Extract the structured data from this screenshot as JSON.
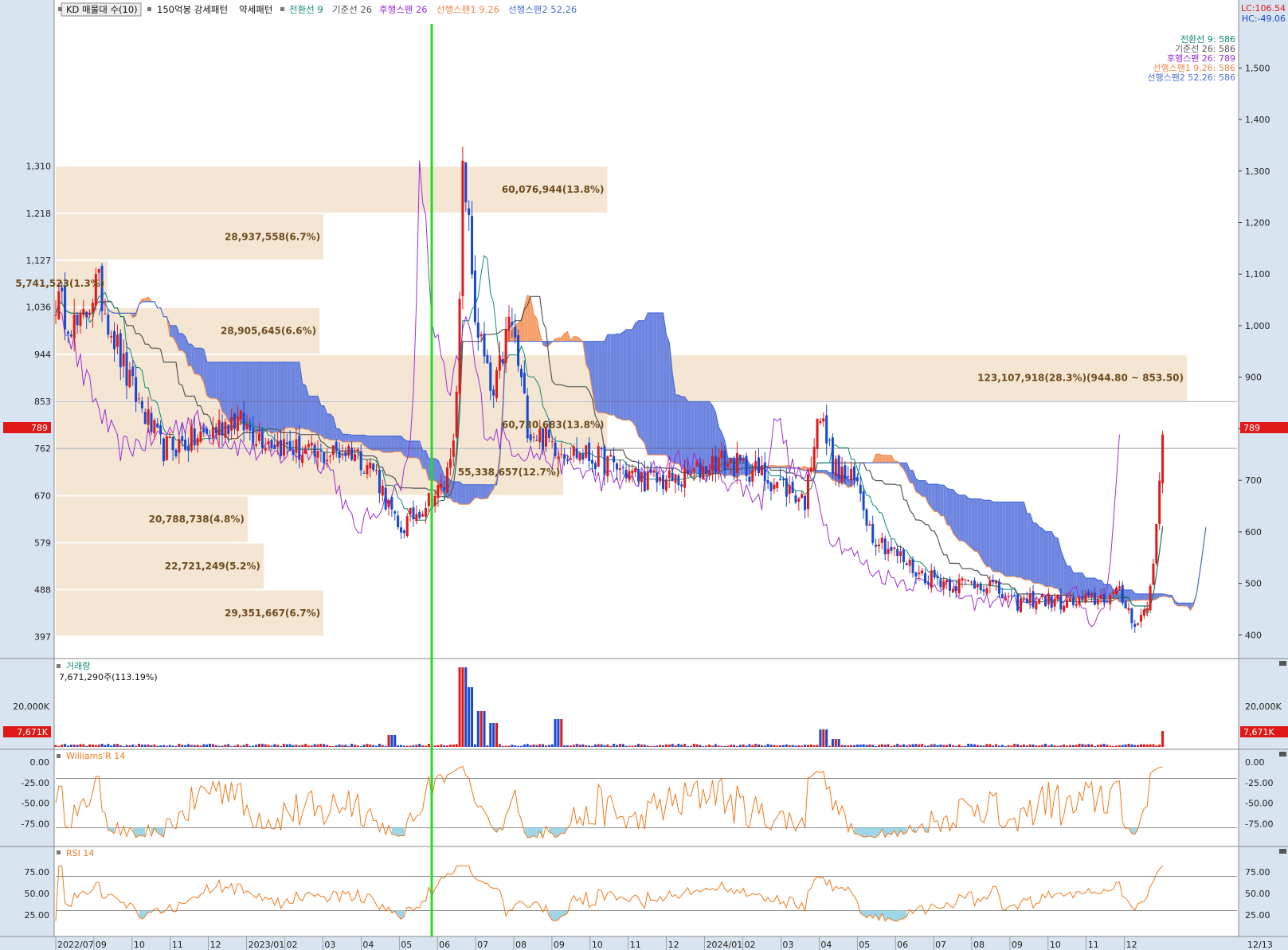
{
  "header": {
    "item1": "KD 매물대 수(10)",
    "item2": "150억봉 강세패턴",
    "item3": "약세패턴",
    "item4": "전환선 9",
    "item5": "기준선 26",
    "item6": "후행스팬 26",
    "item7": "선행스팬1 9,26",
    "item8": "선행스팬2 52,26"
  },
  "corner": {
    "lc": "LC:106.54",
    "hc": "HC:-49.06"
  },
  "legend": [
    {
      "text": "전환선 9: 586",
      "color": "#0c8a74"
    },
    {
      "text": "기준선 26: 586",
      "color": "#555555"
    },
    {
      "text": "후행스팬 26: 789",
      "color": "#9b2fd6"
    },
    {
      "text": "선행스팬1 9,26: 586",
      "color": "#f0884a"
    },
    {
      "text": "선행스팬2 52,26: 586",
      "color": "#4a6fd6"
    }
  ],
  "colors": {
    "up": "#e01818",
    "down": "#1848d0",
    "tenkan": "#0c8a74",
    "kijun": "#555555",
    "chikou": "#9b2fd6",
    "spanA": "#f0884a",
    "spanB": "#4a6fd6",
    "cloudUp": "#f5a06a",
    "cloudDown": "#6f86e0",
    "vp": "#f5e6d4",
    "indicator": "#ef7a1e",
    "osFill": "#9cd6e8",
    "green": "#22dd22"
  },
  "chart_data": [
    {
      "type": "candlestick",
      "title": "",
      "x_axis_labels": [
        "2022/07",
        "09",
        "10",
        "11",
        "12",
        "2023/01",
        "02",
        "03",
        "04",
        "05",
        "06",
        "07",
        "08",
        "09",
        "10",
        "11",
        "12",
        "2024/01",
        "02",
        "03",
        "04",
        "05",
        "06",
        "07",
        "08",
        "09",
        "10",
        "11",
        "12"
      ],
      "x_axis_end": "12/13",
      "left_ticks": [
        "1,310",
        "1,218",
        "1,127",
        "1,036",
        "944",
        "853",
        "762",
        "670",
        "579",
        "488",
        "397"
      ],
      "right_ticks": [
        "1,500",
        "1,400",
        "1,300",
        "1,200",
        "1,100",
        "1,000",
        "900",
        "800",
        "700",
        "600",
        "500",
        "400"
      ],
      "price_range": [
        365,
        1570
      ],
      "current_price": "789",
      "price_path": [
        [
          0,
          1050
        ],
        [
          0.02,
          990
        ],
        [
          0.035,
          1085
        ],
        [
          0.06,
          900
        ],
        [
          0.09,
          760
        ],
        [
          0.12,
          780
        ],
        [
          0.15,
          820
        ],
        [
          0.17,
          790
        ],
        [
          0.19,
          770
        ],
        [
          0.22,
          745
        ],
        [
          0.25,
          760
        ],
        [
          0.27,
          720
        ],
        [
          0.29,
          600
        ],
        [
          0.31,
          650
        ],
        [
          0.33,
          690
        ],
        [
          0.34,
          860
        ],
        [
          0.345,
          1330
        ],
        [
          0.355,
          1020
        ],
        [
          0.37,
          850
        ],
        [
          0.385,
          1020
        ],
        [
          0.4,
          800
        ],
        [
          0.43,
          760
        ],
        [
          0.46,
          740
        ],
        [
          0.48,
          720
        ],
        [
          0.5,
          700
        ],
        [
          0.53,
          700
        ],
        [
          0.56,
          740
        ],
        [
          0.59,
          720
        ],
        [
          0.615,
          690
        ],
        [
          0.635,
          660
        ],
        [
          0.645,
          840
        ],
        [
          0.66,
          720
        ],
        [
          0.68,
          690
        ],
        [
          0.69,
          600
        ],
        [
          0.71,
          560
        ],
        [
          0.73,
          520
        ],
        [
          0.76,
          500
        ],
        [
          0.79,
          500
        ],
        [
          0.81,
          460
        ],
        [
          0.83,
          470
        ],
        [
          0.86,
          460
        ],
        [
          0.88,
          470
        ],
        [
          0.9,
          480
        ],
        [
          0.915,
          420
        ],
        [
          0.925,
          460
        ],
        [
          0.93,
          560
        ],
        [
          0.937,
          789
        ]
      ],
      "volume_profile": [
        {
          "label": "29,351,667(6.7%)",
          "range": [
            397,
            488
          ],
          "pct": 6.7
        },
        {
          "label": "22,721,249(5.2%)",
          "range": [
            488,
            579
          ],
          "pct": 5.2
        },
        {
          "label": "20,788,738(4.8%)",
          "range": [
            579,
            670
          ],
          "pct": 4.8
        },
        {
          "label": "55,338,657(12.7%)",
          "range": [
            670,
            762
          ],
          "pct": 12.7
        },
        {
          "label": "60,730,683(13.8%)",
          "range": [
            762,
            853
          ],
          "pct": 13.8
        },
        {
          "label": "123,107,918(28.3%)(944.80 ~ 853.50)",
          "range": [
            853,
            944
          ],
          "pct": 28.3
        },
        {
          "label": "28,905,645(6.6%)",
          "range": [
            944,
            1036
          ],
          "pct": 6.6
        },
        {
          "label": "5,741,523(1.3%)",
          "range": [
            1036,
            1127
          ],
          "pct": 1.3
        },
        {
          "label": "28,937,558(6.7%)",
          "range": [
            1127,
            1218
          ],
          "pct": 6.7
        },
        {
          "label": "60,076,944(13.8%)",
          "range": [
            1218,
            1310
          ],
          "pct": 13.8
        }
      ]
    },
    {
      "type": "bar",
      "title": "거래량",
      "info": "7,671,290주(113.19%)",
      "left_tick": "20,000K",
      "right_tick": "20,000K",
      "current": "7,671K",
      "spikes": [
        [
          0.345,
          1.0
        ],
        [
          0.35,
          0.75
        ],
        [
          0.36,
          0.45
        ],
        [
          0.37,
          0.3
        ],
        [
          0.425,
          0.35
        ],
        [
          0.285,
          0.15
        ],
        [
          0.65,
          0.22
        ],
        [
          0.66,
          0.1
        ],
        [
          0.94,
          0.2
        ]
      ]
    },
    {
      "type": "line",
      "title": "Williams'R 14",
      "ticks": [
        "0.00",
        "-25.00",
        "-50.00",
        "-75.00"
      ],
      "range": [
        -100,
        0
      ],
      "levels": [
        -20,
        -80
      ]
    },
    {
      "type": "line",
      "title": "RSI 14",
      "ticks": [
        "75.00",
        "50.00",
        "25.00"
      ],
      "range": [
        0,
        100
      ],
      "levels": [
        70,
        30
      ]
    }
  ]
}
